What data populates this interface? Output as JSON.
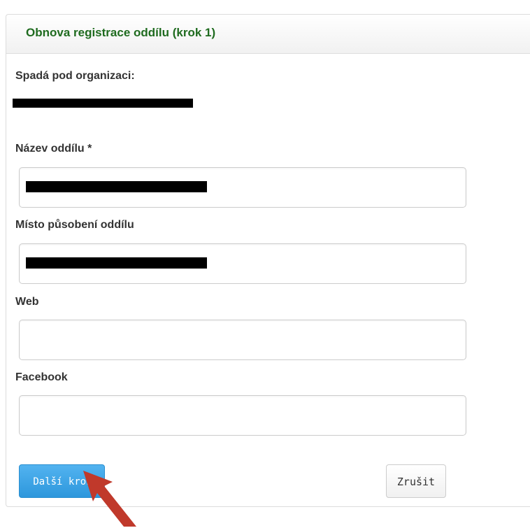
{
  "header": {
    "title": "Obnova registrace oddílu (krok 1)"
  },
  "organization": {
    "label": "Spadá pod organizaci:",
    "value": "",
    "redacted": true
  },
  "fields": {
    "name": {
      "label": "Název oddílu *",
      "value": "",
      "redacted": true
    },
    "location": {
      "label": "Místo působení oddílu",
      "value": "",
      "redacted": true
    },
    "web": {
      "label": "Web",
      "value": ""
    },
    "facebook": {
      "label": "Facebook",
      "value": ""
    }
  },
  "buttons": {
    "next_label": "Další krok",
    "cancel_label": "Zrušit"
  },
  "colors": {
    "title": "#1f6b1f",
    "primary_button": "#3aa3e6",
    "annotation_arrow": "#c0392b",
    "redaction": "#000000"
  },
  "icons": {
    "annotation": "pointer-arrow-icon"
  }
}
